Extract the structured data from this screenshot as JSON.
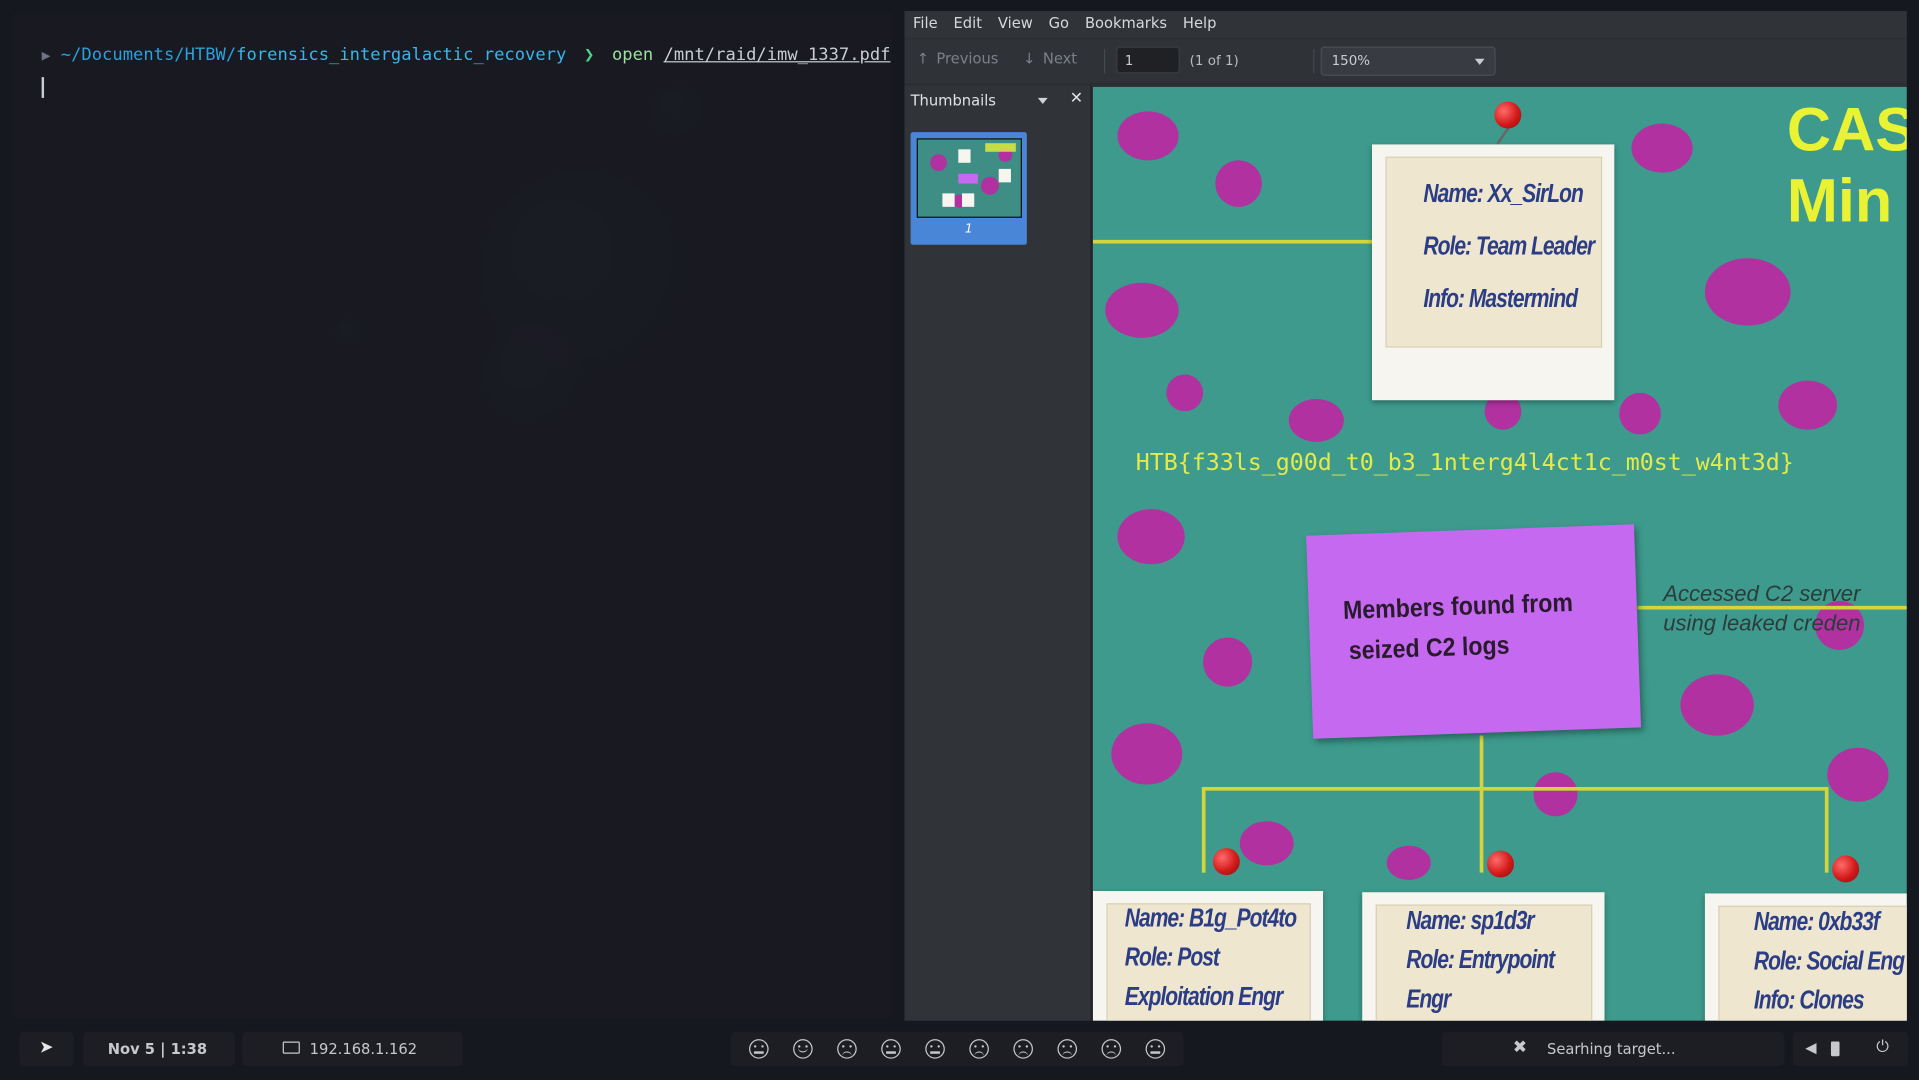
{
  "terminal": {
    "path_prefix": "~/Documents/HTBW/",
    "path_dir": "forensics_intergalactic_recovery",
    "command": "open",
    "argument": "/mnt/raid/imw_1337.pdf"
  },
  "viewer": {
    "menu": [
      "File",
      "Edit",
      "View",
      "Go",
      "Bookmarks",
      "Help"
    ],
    "toolbar": {
      "previous_label": "Previous",
      "next_label": "Next",
      "page_value": "1",
      "page_count": "(1 of 1)",
      "zoom_value": "150%"
    },
    "sidebar": {
      "title": "Thumbnails",
      "thumb_label": "1"
    },
    "document": {
      "case_title_line1": "CAS",
      "case_title_line2": "Min",
      "leader_card": {
        "name": "Name: Xx_SirLon",
        "role": "Role: Team Leader",
        "info": "Info: Mastermind"
      },
      "flag": "HTB{f33ls_g00d_t0_b3_1nterg4l4ct1c_m0st_w4nt3d}",
      "sticky_line1": "Members found from",
      "sticky_line2": "seized C2 logs",
      "c2_note_line1": "Accessed C2 server",
      "c2_note_line2": "using leaked creden",
      "member_cards": [
        {
          "name": "Name: B1g_Pot4to",
          "role": "Role: Post",
          "info": "Exploitation Engr"
        },
        {
          "name": "Name: sp1d3r",
          "role": "Role: Entrypoint",
          "info": "Engr"
        },
        {
          "name": "Name: 0xb33f",
          "role": "Role: Social Eng",
          "info": "Info: Clones"
        }
      ]
    }
  },
  "taskbar": {
    "datetime": "Nov 5 | 1:38",
    "ip": "192.168.1.162",
    "status": "Searhing target...",
    "emojis": [
      "neutral",
      "smile",
      "frown",
      "neutral",
      "neutral",
      "frown",
      "frown",
      "frown",
      "frown",
      "neutral"
    ]
  }
}
